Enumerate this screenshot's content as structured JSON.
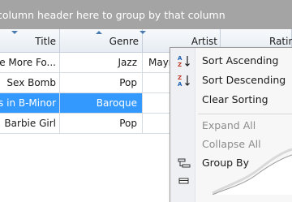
{
  "group_panel": {
    "hint": "column header here to group by that column"
  },
  "columns": [
    {
      "key": "title",
      "label": "Title"
    },
    {
      "key": "genre",
      "label": "Genre"
    },
    {
      "key": "artist",
      "label": "Artist"
    },
    {
      "key": "rating",
      "label": "Ratin"
    }
  ],
  "rows": [
    {
      "title": "e More Fo...",
      "genre": "Jazz",
      "artist": "Mayn",
      "selected": false
    },
    {
      "title": "Sex Bomb",
      "genre": "Pop",
      "artist": "",
      "selected": false
    },
    {
      "title": "s in B-Minor",
      "genre": "Baroque",
      "artist": "",
      "selected": true
    },
    {
      "title": "Barbie Girl",
      "genre": "Pop",
      "artist": "",
      "selected": false
    }
  ],
  "context_menu": {
    "items": [
      {
        "label": "Sort Ascending",
        "icon": "sort-ascending-icon",
        "enabled": true
      },
      {
        "label": "Sort Descending",
        "icon": "sort-descending-icon",
        "enabled": true
      },
      {
        "label": "Clear Sorting",
        "icon": "",
        "enabled": true
      },
      {
        "label": "Expand All",
        "icon": "",
        "enabled": false
      },
      {
        "label": "Collapse All",
        "icon": "",
        "enabled": false
      },
      {
        "label": "Group By",
        "icon": "group-by-icon",
        "enabled": true
      }
    ]
  },
  "colors": {
    "selection": "#3399ff",
    "group_panel": "#a4a4a4",
    "sort_indicator": "#4a7bb0",
    "icon_blue": "#1a5fb4",
    "icon_red": "#c0392b"
  }
}
